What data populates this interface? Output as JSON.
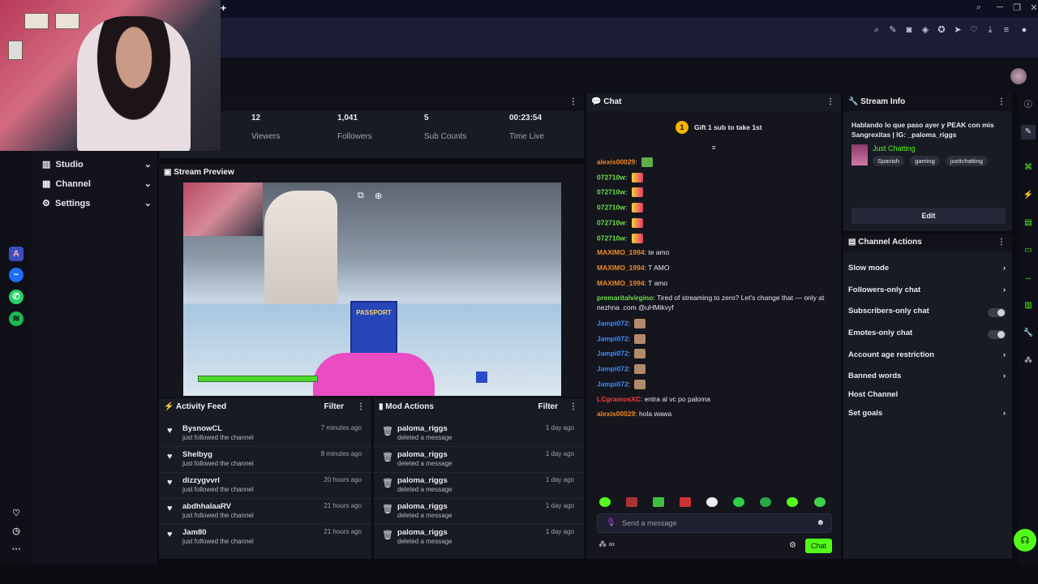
{
  "browser": {
    "new_tab_icon": "plus-icon",
    "win_controls": [
      "search-icon",
      "minimize-icon",
      "restore-icon",
      "close-icon"
    ]
  },
  "stats": [
    {
      "value": "12",
      "label": "Viewers"
    },
    {
      "value": "1,041",
      "label": "Followers"
    },
    {
      "value": "5",
      "label": "Sub Counts"
    },
    {
      "value": "00:23:54",
      "label": "Time Live"
    }
  ],
  "nav": {
    "items": [
      "Studio",
      "Channel",
      "Settings"
    ]
  },
  "preview": {
    "title": "Stream Preview",
    "passport_text": "PASSPORT"
  },
  "activity": {
    "title": "Activity Feed",
    "filter": "Filter",
    "rows": [
      {
        "name": "BysnowCL",
        "sub": "just followed the channel",
        "time": "7 minutes ago"
      },
      {
        "name": "Shelbyg",
        "sub": "just followed the channel",
        "time": "8 minutes ago"
      },
      {
        "name": "dizzygvvrl",
        "sub": "just followed the channel",
        "time": "20 hours ago"
      },
      {
        "name": "abdhhalaaRV",
        "sub": "just followed the channel",
        "time": "21 hours ago"
      },
      {
        "name": "Jam80",
        "sub": "just followed the channel",
        "time": "21 hours ago"
      }
    ]
  },
  "mod": {
    "title": "Mod Actions",
    "filter": "Filter",
    "rows": [
      {
        "name": "paloma_riggs",
        "sub": "deleted a message",
        "time": "1 day ago"
      },
      {
        "name": "paloma_riggs",
        "sub": "deleted a message",
        "time": "1 day ago"
      },
      {
        "name": "paloma_riggs",
        "sub": "deleted a message",
        "time": "1 day ago"
      },
      {
        "name": "paloma_riggs",
        "sub": "deleted a message",
        "time": "1 day ago"
      },
      {
        "name": "paloma_riggs",
        "sub": "deleted a message",
        "time": "1 day ago"
      }
    ]
  },
  "chat": {
    "title": "Chat",
    "gift_badge": "1",
    "gift_text": "Gift 1 sub to take 1st",
    "messages": [
      {
        "user": "alexis00029",
        "text": "",
        "color": "#f08a24",
        "emote": true
      },
      {
        "user": "072710w",
        "text": "",
        "color": "#6ee04a",
        "emote": true
      },
      {
        "user": "072710w",
        "text": "",
        "color": "#6ee04a",
        "emote": true
      },
      {
        "user": "072710w",
        "text": "",
        "color": "#6ee04a",
        "emote": true
      },
      {
        "user": "072710w",
        "text": "",
        "color": "#6ee04a",
        "emote": true
      },
      {
        "user": "072710w",
        "text": "",
        "color": "#6ee04a",
        "emote": true
      },
      {
        "user": "MAXIMO_1994",
        "text": "te amo",
        "color": "#f08a24",
        "emote": false
      },
      {
        "user": "MAXIMO_1994",
        "text": "T AMO",
        "color": "#f08a24",
        "emote": false
      },
      {
        "user": "MAXIMO_1994",
        "text": "T amo",
        "color": "#f08a24",
        "emote": false
      },
      {
        "user": "premaritalvirgino",
        "text": "Tired of streaming to zero? Let's change that — only at",
        "text2": "nezhna .com @uHMikvyf",
        "color": "#6ee04a",
        "emote": false
      },
      {
        "user": "Jampi072",
        "text": "",
        "color": "#3d8bff",
        "emote": true
      },
      {
        "user": "Jampi072",
        "text": "",
        "color": "#3d8bff",
        "emote": true
      },
      {
        "user": "Jampi072",
        "text": "",
        "color": "#3d8bff",
        "emote": true
      },
      {
        "user": "Jampi072",
        "text": "",
        "color": "#3d8bff",
        "emote": true
      },
      {
        "user": "Jampi072",
        "text": "",
        "color": "#3d8bff",
        "emote": true
      },
      {
        "user": "LCgramosXC",
        "text": "entra al vc po paloma",
        "color": "#ff3b3b",
        "emote": false
      },
      {
        "user": "alexis00029",
        "text": "hola wawa",
        "color": "#f08a24",
        "emote": false
      }
    ],
    "input_placeholder": "Send a message",
    "send_label": "Chat"
  },
  "stream_info": {
    "title": "Stream Info",
    "stream_title": "Hablando lo que paso ayer y PEAK con mis Sangrexitas | IG: _paloma_riggs",
    "category": "Just Chatting",
    "tags": [
      "Spanish",
      "gaming",
      "justtchatting"
    ],
    "edit_label": "Edit"
  },
  "channel_actions": {
    "title": "Channel Actions",
    "rows": [
      {
        "label": "Slow mode",
        "kind": "chevron"
      },
      {
        "label": "Followers-only chat",
        "kind": "chevron"
      },
      {
        "label": "Subscribers-only chat",
        "kind": "toggle"
      },
      {
        "label": "Emotes-only chat",
        "kind": "toggle"
      },
      {
        "label": "Account age restriction",
        "kind": "chevron"
      },
      {
        "label": "Banned words",
        "kind": "chevron"
      },
      {
        "label": "Host Channel",
        "kind": "none"
      },
      {
        "label": "Set goals",
        "kind": "chevron"
      }
    ]
  },
  "colors": {
    "accent": "#53fc18",
    "panel": "#181a24",
    "bg": "#0b0c12"
  }
}
